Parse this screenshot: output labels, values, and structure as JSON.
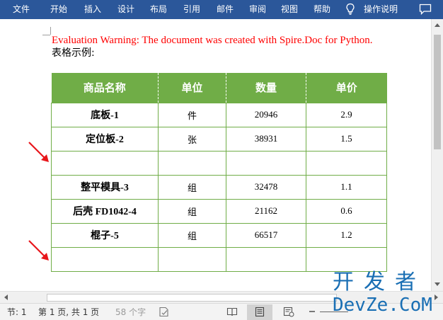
{
  "ribbon": {
    "tabs": [
      "文件",
      "开始",
      "插入",
      "设计",
      "布局",
      "引用",
      "邮件",
      "审阅",
      "视图",
      "帮助"
    ],
    "tell_me": "操作说明"
  },
  "document": {
    "warning": "Evaluation Warning: The document was created with Spire.Doc for Python.",
    "label": "表格示例:",
    "table": {
      "headers": [
        "商品名称",
        "单位",
        "数量",
        "单价"
      ],
      "rows": [
        [
          "底板-1",
          "件",
          "20946",
          "2.9"
        ],
        [
          "定位板-2",
          "张",
          "38931",
          "1.5"
        ],
        [
          "",
          "",
          "",
          ""
        ],
        [
          "整平模具-3",
          "组",
          "32478",
          "1.1"
        ],
        [
          "后壳 FD1042-4",
          "组",
          "21162",
          "0.6"
        ],
        [
          "棍子-5",
          "组",
          "66517",
          "1.2"
        ],
        [
          "",
          "",
          "",
          ""
        ]
      ]
    }
  },
  "status_bar": {
    "section": "节: 1",
    "page": "第 1 页, 共 1 页",
    "word_count": "58 个字"
  },
  "watermark": {
    "chinese": "开发者",
    "english": "DevZe.CoM"
  },
  "colors": {
    "ribbon": "#2b579a",
    "table_header": "#70ad47",
    "warning_text": "#ff0000",
    "arrow": "#e8161b",
    "watermark": "#1a6fb4"
  }
}
